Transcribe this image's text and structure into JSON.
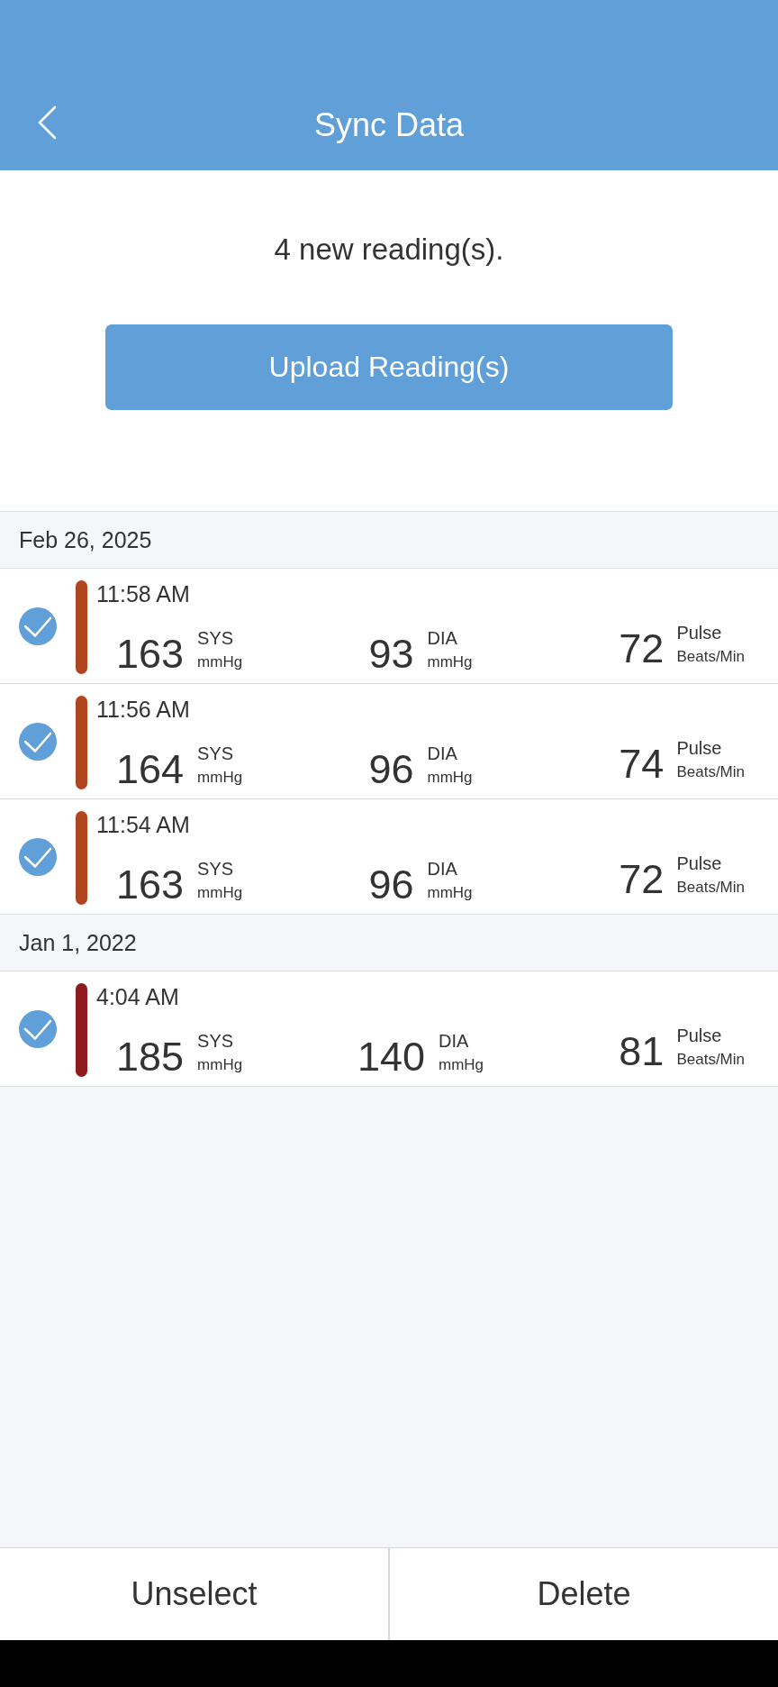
{
  "header": {
    "title": "Sync Data"
  },
  "summary": "4 new reading(s).",
  "upload_button": "Upload Reading(s)",
  "groups": [
    {
      "date": "Feb 26, 2025",
      "readings": [
        {
          "time": "11:58 AM",
          "checked": true,
          "color": "#b0461f",
          "systolic": "163",
          "systolic_label": "SYS",
          "systolic_unit": "mmHg",
          "diastolic": "93",
          "diastolic_label": "DIA",
          "diastolic_unit": "mmHg",
          "pulse": "72",
          "pulse_label": "Pulse",
          "pulse_unit": "Beats/Min"
        },
        {
          "time": "11:56 AM",
          "checked": true,
          "color": "#b0461f",
          "systolic": "164",
          "systolic_label": "SYS",
          "systolic_unit": "mmHg",
          "diastolic": "96",
          "diastolic_label": "DIA",
          "diastolic_unit": "mmHg",
          "pulse": "74",
          "pulse_label": "Pulse",
          "pulse_unit": "Beats/Min"
        },
        {
          "time": "11:54 AM",
          "checked": true,
          "color": "#b0461f",
          "systolic": "163",
          "systolic_label": "SYS",
          "systolic_unit": "mmHg",
          "diastolic": "96",
          "diastolic_label": "DIA",
          "diastolic_unit": "mmHg",
          "pulse": "72",
          "pulse_label": "Pulse",
          "pulse_unit": "Beats/Min"
        }
      ]
    },
    {
      "date": "Jan 1, 2022",
      "readings": [
        {
          "time": "4:04 AM",
          "checked": true,
          "color": "#8e1b1d",
          "systolic": "185",
          "systolic_label": "SYS",
          "systolic_unit": "mmHg",
          "diastolic": "140",
          "diastolic_label": "DIA",
          "diastolic_unit": "mmHg",
          "pulse": "81",
          "pulse_label": "Pulse",
          "pulse_unit": "Beats/Min"
        }
      ]
    }
  ],
  "bottom_bar": {
    "unselect_button": "Unselect",
    "delete_button": "Delete"
  }
}
